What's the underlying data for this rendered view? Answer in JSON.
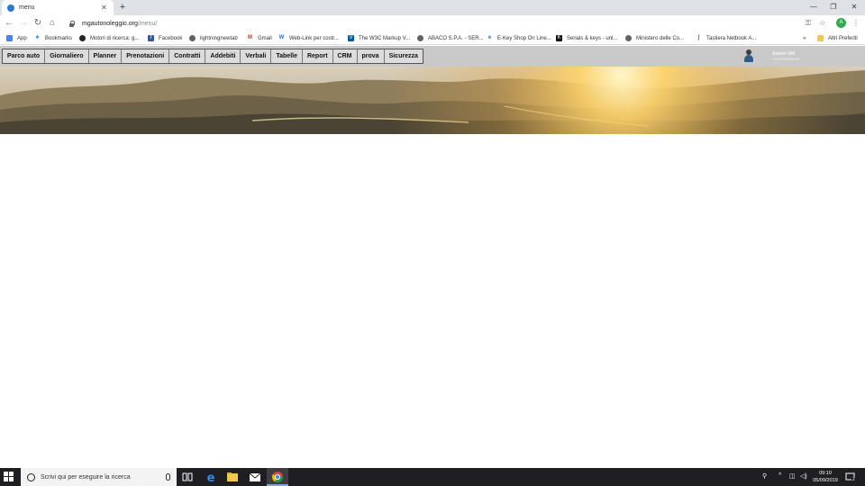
{
  "browser": {
    "tab_title": "menu",
    "url_host": "mgautonoleggio.org",
    "url_path": "/menu/",
    "profile_initial": "A",
    "bookmarks": [
      {
        "label": "App",
        "icon": "apps-grid-icon",
        "color": "#4285f4"
      },
      {
        "label": "Bookmarks",
        "icon": "star-icon",
        "color": "#1a73e8"
      },
      {
        "label": "Motori di ricerca: g...",
        "icon": "globe-dark-icon",
        "color": "#222222"
      },
      {
        "label": "Facebook",
        "icon": "facebook-icon",
        "color": "#3b5998"
      },
      {
        "label": "lightningnewtab",
        "icon": "globe-icon",
        "color": "#5f6368"
      },
      {
        "label": "Gmail",
        "icon": "gmail-icon",
        "color": "#d93025"
      },
      {
        "label": "Web-Link per costr...",
        "icon": "weblink-icon",
        "color": "#1a73e8"
      },
      {
        "label": "The W3C Markup V...",
        "icon": "w3c-icon",
        "color": "#005a9c"
      },
      {
        "label": "ABACO S.P.A. - SER...",
        "icon": "globe-icon",
        "color": "#5f6368"
      },
      {
        "label": "E-Key Shop On Line...",
        "icon": "ekey-icon",
        "color": "#1a73e8"
      },
      {
        "label": "Serials & keys - unl...",
        "icon": "serials-icon",
        "color": "#111111"
      },
      {
        "label": "Ministero delle Co...",
        "icon": "globe-icon",
        "color": "#5f6368"
      },
      {
        "label": "Tastiera Netbook A...",
        "icon": "tastiera-icon",
        "color": "#c0392b"
      }
    ],
    "other_bookmarks": "Altri Preferiti"
  },
  "page": {
    "menu": [
      "Parco auto",
      "Giornaliero",
      "Planner",
      "Prenotazioni",
      "Contratti",
      "Addebiti",
      "Verbali",
      "Tabelle",
      "Report",
      "CRM",
      "prova",
      "Sicurezza"
    ],
    "user_name": "Admin 000",
    "user_role": "Amministratore"
  },
  "taskbar": {
    "search_placeholder": "Scrivi qui per eseguire la ricerca",
    "time": "09:10",
    "date": "05/09/2019",
    "notification_count": "2"
  }
}
